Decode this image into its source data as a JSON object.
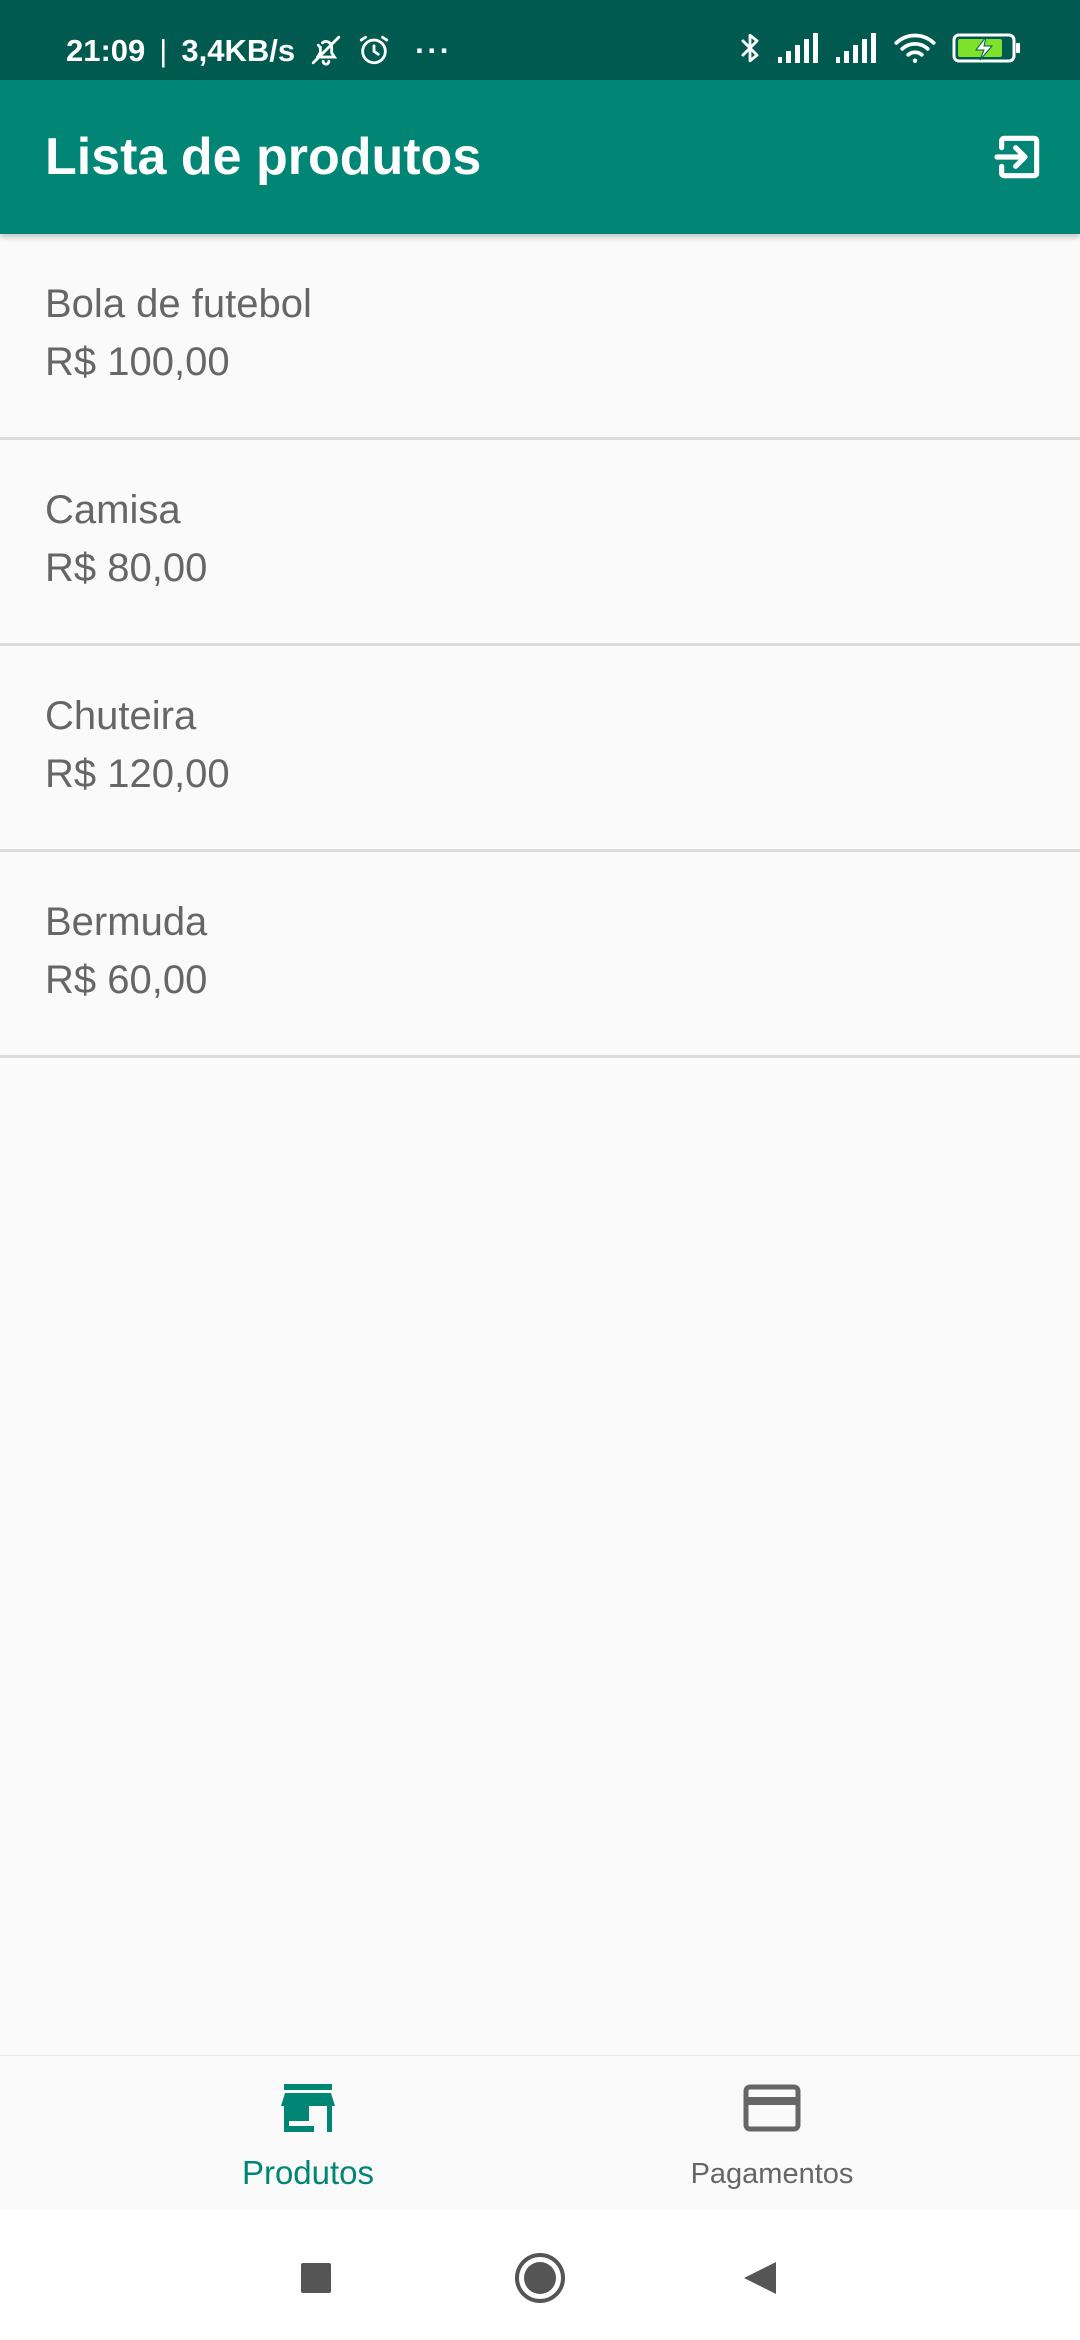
{
  "status_bar": {
    "time": "21:09",
    "separator": "|",
    "network_speed": "3,4KB/s",
    "more": "···",
    "icons": [
      "bell-off-icon",
      "alarm-icon",
      "bluetooth-icon",
      "signal-icon",
      "signal-icon",
      "wifi-icon",
      "battery-charging-icon"
    ]
  },
  "app_bar": {
    "title": "Lista de produtos",
    "action_icon": "logout-icon"
  },
  "products": [
    {
      "name": "Bola de futebol",
      "price": "R$ 100,00"
    },
    {
      "name": "Camisa",
      "price": "R$ 80,00"
    },
    {
      "name": "Chuteira",
      "price": "R$ 120,00"
    },
    {
      "name": "Bermuda",
      "price": "R$ 60,00"
    }
  ],
  "bottom_nav": {
    "items": [
      {
        "label": "Produtos",
        "icon": "store-icon",
        "active": true
      },
      {
        "label": "Pagamentos",
        "icon": "credit-card-icon",
        "active": false
      }
    ]
  },
  "system_nav": {
    "buttons": [
      "recents-icon",
      "home-icon",
      "back-icon"
    ]
  },
  "colors": {
    "status_bar": "#005a4f",
    "primary": "#018675",
    "text_secondary": "#666666",
    "background": "#fafafa",
    "battery_accent": "#7ee12b"
  }
}
